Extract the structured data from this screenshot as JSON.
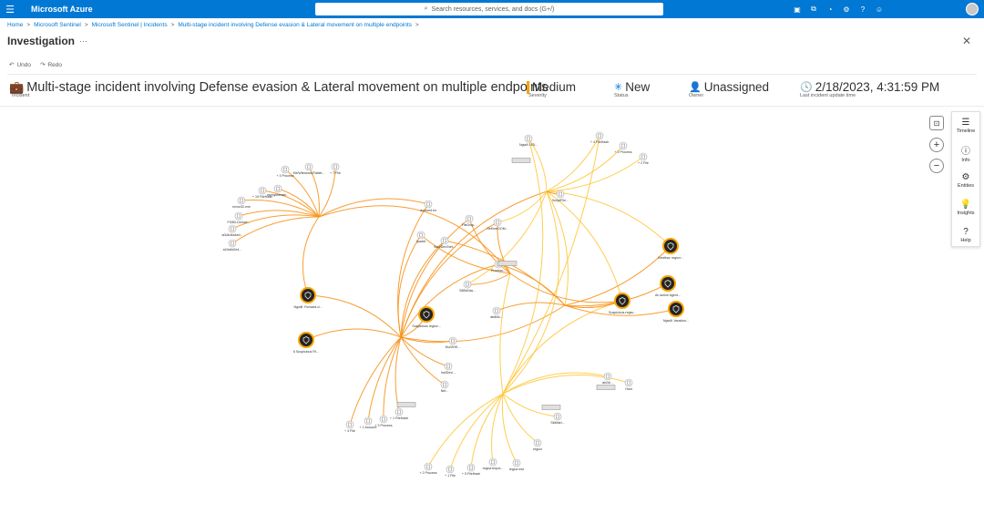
{
  "topbar": {
    "brand": "Microsoft Azure",
    "search_placeholder": "Search resources, services, and docs (G+/)",
    "icons": [
      "cloud-shell-icon",
      "directory-icon",
      "bell-icon",
      "gear-icon",
      "help-icon",
      "feedback-icon"
    ]
  },
  "breadcrumb": {
    "items": [
      "Home",
      "Microsoft Sentinel",
      "Microsoft Sentinel | Incidents",
      "Multi-stage incident involving Defense evasion & Lateral movement on multiple endpoints"
    ],
    "separator": ">"
  },
  "page": {
    "title": "Investigation",
    "more": "···",
    "close": "✕"
  },
  "toolbar": {
    "undo": "Undo",
    "redo": "Redo"
  },
  "incident": {
    "title": "Multi-stage incident involving Defense evasion & Lateral movement on multiple endpoints",
    "title_label": "Incident",
    "severity": "Medium",
    "severity_label": "Severity",
    "status": "New",
    "status_label": "Status",
    "owner": "Unassigned",
    "owner_label": "Owner",
    "updated": "2/18/2023, 4:31:59 PM",
    "updated_label": "Last incident update time"
  },
  "side_panel": {
    "items": [
      {
        "label": "Timeline",
        "icon": "timeline-icon"
      },
      {
        "label": "Info",
        "icon": "info-icon"
      },
      {
        "label": "Entities",
        "icon": "entities-icon"
      },
      {
        "label": "Insights",
        "icon": "lightbulb-icon"
      },
      {
        "label": "Help",
        "icon": "help-icon"
      }
    ]
  },
  "graph": {
    "edge_colors": {
      "orange": "#f7941d",
      "yellow": "#ffc83d"
    },
    "alerts": [
      {
        "label": "Ngwill: Forward-d..."
      },
      {
        "label": "6 Suspicious Fil..."
      },
      {
        "label": "Suspicious regsvr..."
      },
      {
        "label": "Suspicious regsv..."
      },
      {
        "label": "An active Agent..."
      },
      {
        "label": "Ngwill: Vaustion..."
      },
      {
        "label": "Kinetisa: regsvr..."
      }
    ],
    "entities": [
      {
        "label": "+ 3 Process"
      },
      {
        "label": "Mx/Wlindows/Tablet..."
      },
      {
        "label": "+ 7 File"
      },
      {
        "label": "+ 19 FileHash"
      },
      {
        "label": "mymydomain..."
      },
      {
        "label": "rcrxsr32.exe"
      },
      {
        "label": "FG8D-Deluxe..."
      },
      {
        "label": "a0d4d4a4ed..."
      },
      {
        "label": "a24c6d2e4..."
      },
      {
        "label": "dontwrd.txt"
      },
      {
        "label": "FileDrop..."
      },
      {
        "label": "SeKmeOOM..."
      },
      {
        "label": "Ipaddr"
      },
      {
        "label": "Bad/Dev/Net..."
      },
      {
        "label": "Process..."
      },
      {
        "label": "ab8f4c..."
      },
      {
        "label": "Ngwill 1E5..."
      },
      {
        "label": "+ 4 FileHash"
      },
      {
        "label": "+ 2 Process"
      },
      {
        "label": "+ 2 File"
      },
      {
        "label": "S8Bd2da..."
      },
      {
        "label": "ScriptFile..."
      },
      {
        "label": "Mu/GHK..."
      },
      {
        "label": "Ind/Dev/..."
      },
      {
        "label": "Net..."
      },
      {
        "label": "+ 4 File"
      },
      {
        "label": "+ 1 Account"
      },
      {
        "label": "+ 3 Process"
      },
      {
        "label": "+ 1 FileHash"
      },
      {
        "label": "+ 2 Process"
      },
      {
        "label": "+ 1 File"
      },
      {
        "label": "+ 5 FileHash"
      },
      {
        "label": "regsvr.tmpor..."
      },
      {
        "label": "regsvr.exe"
      },
      {
        "label": "regsvr"
      },
      {
        "label": "S8bfdel..."
      },
      {
        "label": "ab2d/..."
      },
      {
        "label": "Host"
      }
    ]
  }
}
